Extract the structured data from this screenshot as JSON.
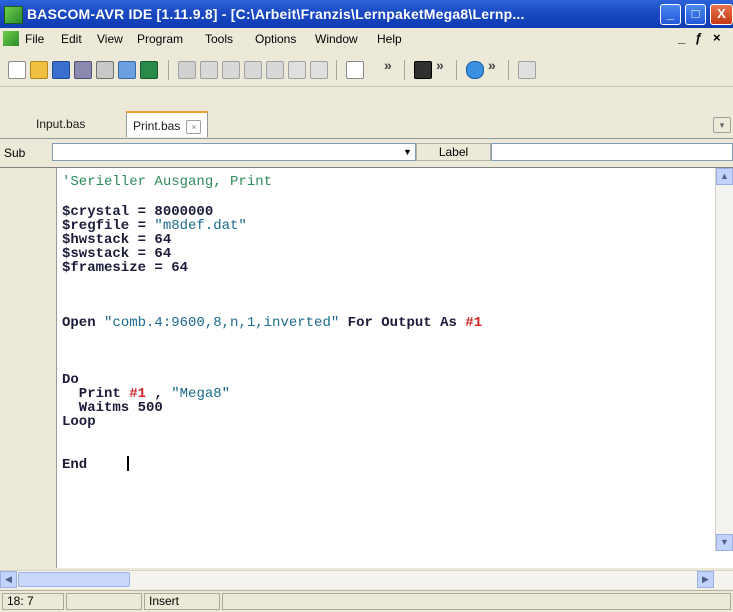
{
  "window": {
    "title": "BASCOM-AVR IDE [1.11.9.8] - [C:\\Arbeit\\Franzis\\LernpaketMega8\\Lernp...",
    "min_glyph": "_",
    "max_glyph": "□",
    "close_glyph": "X",
    "title_color": "#1a49c2"
  },
  "menu": {
    "items": [
      "File",
      "Edit",
      "View",
      "Program",
      "Tools",
      "Options",
      "Window",
      "Help"
    ],
    "mdi_minimize": "_",
    "mdi_restore": "ƒ",
    "mdi_close": "×"
  },
  "toolbar": {
    "icons": [
      "new-file-icon",
      "open-folder-icon",
      "save-icon",
      "save-as-icon",
      "print-icon",
      "print-preview-icon",
      "chip-icon",
      "cut-icon",
      "copy-icon",
      "paste-icon",
      "indent-icon",
      "outdent-icon",
      "find-icon",
      "find-next-icon",
      "bookmark-icon",
      "program-chip-icon",
      "simulate-icon",
      "help-icon"
    ],
    "chevron": "»"
  },
  "tabs": [
    {
      "label": "Input.bas",
      "active": false
    },
    {
      "label": "Print.bas",
      "active": true
    }
  ],
  "subbar": {
    "sub_label": "Sub",
    "sub_value": "",
    "label_button": "Label",
    "label_value": ""
  },
  "editor": {
    "lines": [
      "'Serieller Ausgang, Print",
      "",
      "$crystal = 8000000",
      "$regfile = \"m8def.dat\"",
      "$hwstack = 64",
      "$swstack = 64",
      "$framesize = 64",
      "",
      "",
      "Open \"comb.4:9600,8,n,1,inverted\" For Output As #1",
      "",
      "",
      "Do",
      "  Print #1 , \"Mega8\"",
      "  Waitms 500",
      "Loop",
      "",
      "End"
    ],
    "colors": {
      "comment": "#2e8b57",
      "string": "#1a6a8a",
      "hash": "#d02020"
    }
  },
  "status": {
    "position": "18: 7",
    "cell2": "",
    "mode": "Insert"
  }
}
